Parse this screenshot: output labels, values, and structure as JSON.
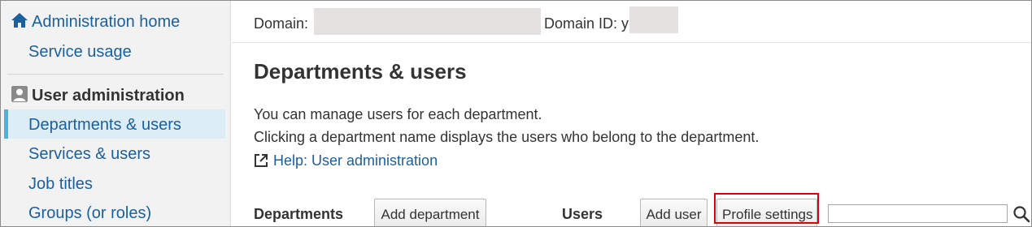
{
  "sidebar": {
    "home": {
      "label": "Administration home",
      "icon": "home-icon"
    },
    "service_usage": {
      "label": "Service usage"
    },
    "section_header": {
      "label": "User administration",
      "icon": "user-icon"
    },
    "items": [
      {
        "label": "Departments & users",
        "active": true
      },
      {
        "label": "Services & users"
      },
      {
        "label": "Job titles"
      },
      {
        "label": "Groups (or roles)"
      }
    ]
  },
  "domain_bar": {
    "domain_label": "Domain:",
    "domain_id_label": "Domain ID: y"
  },
  "main": {
    "title": "Departments & users",
    "description_line1": "You can manage users for each department.",
    "description_line2": "Clicking a department name displays the users who belong to the department.",
    "help_link": "Help: User administration"
  },
  "toolbar": {
    "departments_label": "Departments",
    "add_department_label": "Add department",
    "users_label": "Users",
    "add_user_label": "Add user",
    "profile_settings_label": "Profile settings",
    "search_value": ""
  },
  "colors": {
    "link": "#1a5f9e",
    "active_bg": "#dcedf5",
    "active_accent": "#4fb3d9",
    "highlight": "#e00000",
    "redaction": "#e6e1e1"
  }
}
